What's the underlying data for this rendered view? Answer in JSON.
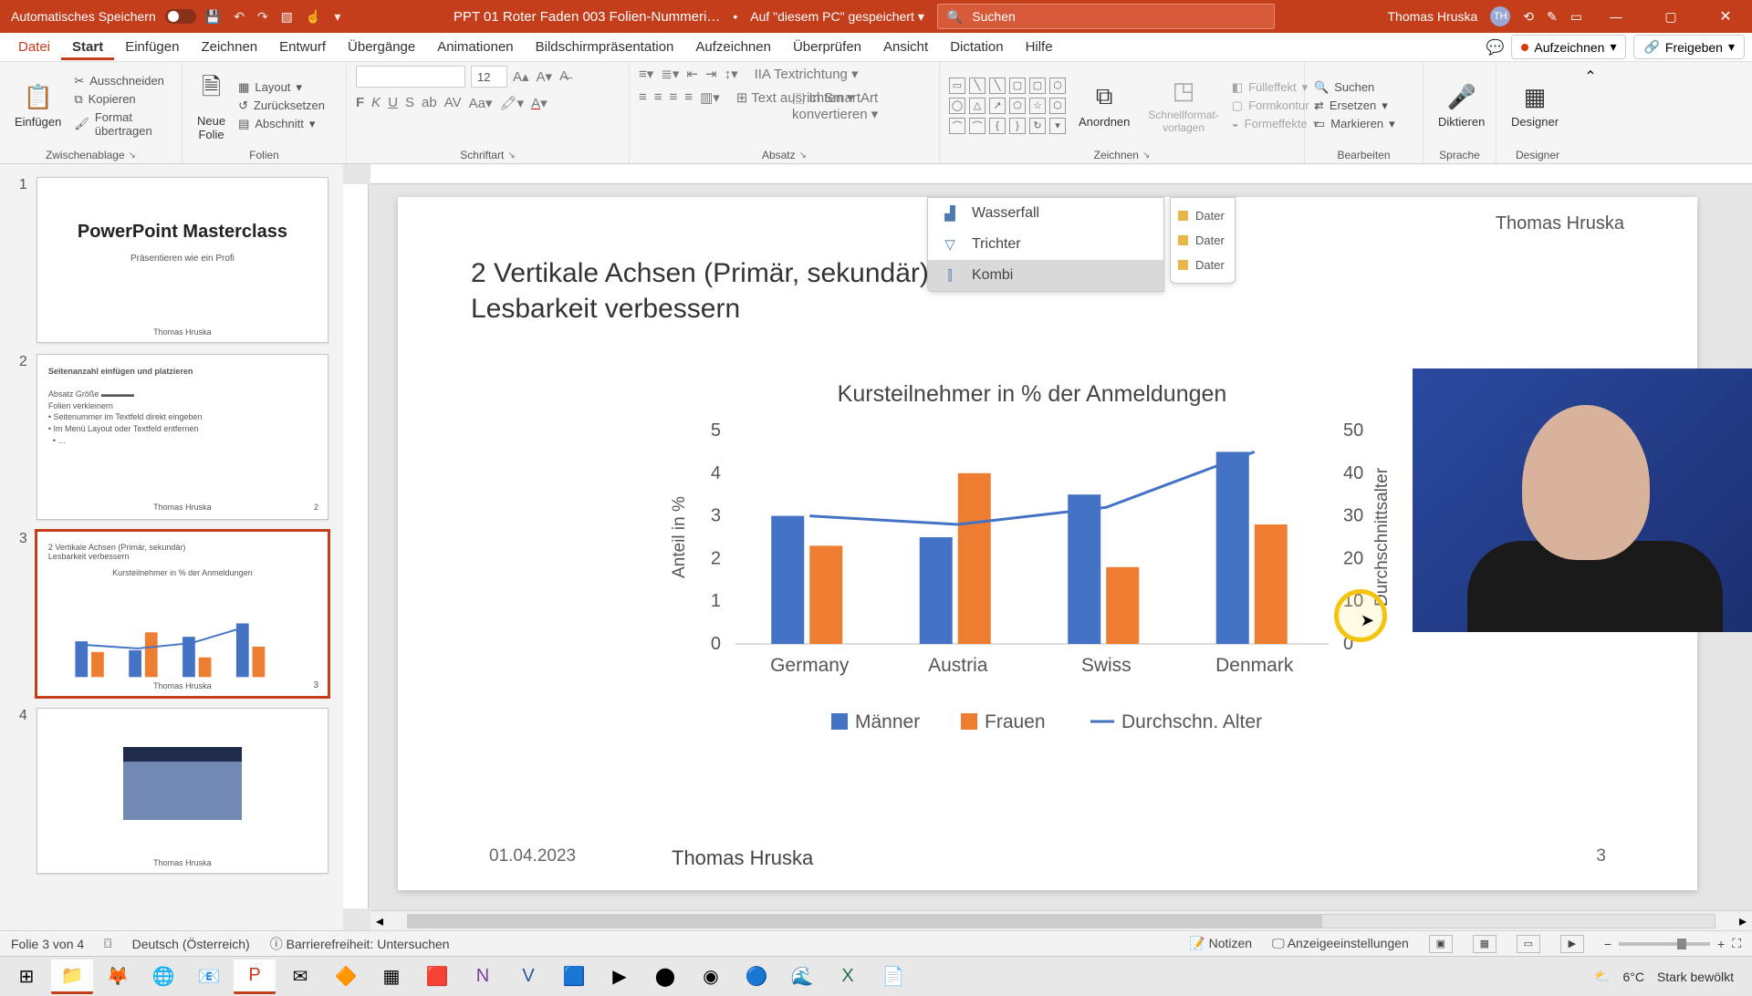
{
  "titlebar": {
    "autosave": "Automatisches Speichern",
    "filename": "PPT 01 Roter Faden 003 Folien-Nummeri…",
    "saved_location": "Auf \"diesem PC\" gespeichert",
    "search_placeholder": "Suchen",
    "username": "Thomas Hruska",
    "user_initials": "TH"
  },
  "tabs": {
    "file": "Datei",
    "home": "Start",
    "insert": "Einfügen",
    "draw": "Zeichnen",
    "design": "Entwurf",
    "transitions": "Übergänge",
    "animations": "Animationen",
    "slideshow": "Bildschirmpräsentation",
    "record": "Aufzeichnen",
    "review": "Überprüfen",
    "view": "Ansicht",
    "dictation": "Dictation",
    "help": "Hilfe",
    "record_btn": "Aufzeichnen",
    "share_btn": "Freigeben"
  },
  "ribbon": {
    "paste": "Einfügen",
    "cut": "Ausschneiden",
    "copy": "Kopieren",
    "format_painter": "Format übertragen",
    "clipboard": "Zwischenablage",
    "new_slide": "Neue\nFolie",
    "layout": "Layout",
    "reset": "Zurücksetzen",
    "section": "Abschnitt",
    "slides": "Folien",
    "font": "Schriftart",
    "font_size": "12",
    "paragraph": "Absatz",
    "text_dir": "Textrichtung",
    "text_align": "Text ausrichten",
    "smartart": "In SmartArt konvertieren",
    "arrange": "Anordnen",
    "quickstyles": "Schnellformat-\nvorlagen",
    "fill": "Fülleffekt",
    "outline": "Formkontur",
    "effects": "Formeffekte",
    "drawing": "Zeichnen",
    "find": "Suchen",
    "replace": "Ersetzen",
    "select": "Markieren",
    "editing": "Bearbeiten",
    "dictate": "Diktieren",
    "voice": "Sprache",
    "designer": "Designer",
    "designer_grp": "Designer"
  },
  "thumbs": {
    "t1_title": "PowerPoint Masterclass",
    "t1_sub": "Präsentieren wie ein Profi",
    "t1_foot": "Thomas Hruska",
    "t2_title": "Seitenanzahl einfügen und platzieren",
    "t3_title": "Kursteilnehmer in % der Anmeldungen",
    "foot": "Thomas Hruska"
  },
  "slide": {
    "author": "Thomas Hruska",
    "heading1": "2 Vertikale Achsen (Primär, sekundär)",
    "heading2": "Lesbarkeit verbessern",
    "menu_waterfall": "Wasserfall",
    "menu_funnel": "Trichter",
    "menu_combo": "Kombi",
    "legend_item": "Dater",
    "footer_date": "01.04.2023",
    "footer_name": "Thomas Hruska",
    "footer_page": "3"
  },
  "chart_data": {
    "type": "bar",
    "title": "Kursteilnehmer in % der Anmeldungen",
    "categories": [
      "Germany",
      "Austria",
      "Swiss",
      "Denmark"
    ],
    "series": [
      {
        "name": "Männer",
        "values": [
          3.0,
          2.5,
          3.5,
          4.5
        ],
        "color": "#4472c4"
      },
      {
        "name": "Frauen",
        "values": [
          2.3,
          4.0,
          1.8,
          2.8
        ],
        "color": "#ed7d31"
      }
    ],
    "line_series": {
      "name": "Durchschn. Alter",
      "values": [
        30,
        28,
        32,
        45
      ],
      "color": "#4472c4"
    },
    "y1": {
      "label": "Anteil in %",
      "min": 0,
      "max": 5,
      "ticks": [
        0,
        1,
        2,
        3,
        4,
        5
      ]
    },
    "y2": {
      "label": "Durchschnittsalter",
      "min": 0,
      "max": 50,
      "ticks": [
        0,
        10,
        20,
        30,
        40,
        50
      ]
    }
  },
  "status": {
    "slide_of": "Folie 3 von 4",
    "language": "Deutsch (Österreich)",
    "accessibility": "Barrierefreiheit: Untersuchen",
    "notes": "Notizen",
    "display": "Anzeigeeinstellungen"
  },
  "tray": {
    "temp": "6°C",
    "weather": "Stark bewölkt"
  }
}
